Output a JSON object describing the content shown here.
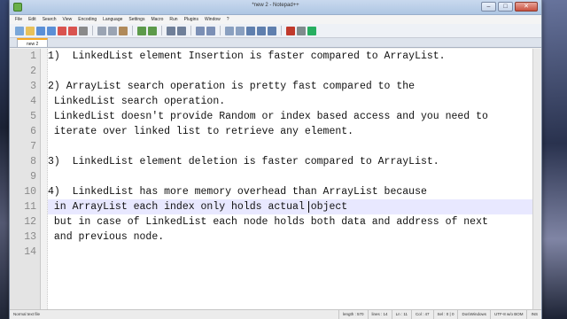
{
  "window": {
    "title": "*new 2 - Notepad++",
    "controls": {
      "minimize": "–",
      "maximize": "□",
      "close": "✕"
    }
  },
  "menu": [
    "File",
    "Edit",
    "Search",
    "View",
    "Encoding",
    "Language",
    "Settings",
    "Macro",
    "Run",
    "Plugins",
    "Window",
    "?"
  ],
  "toolbar_icons": [
    "new-file-icon",
    "open-file-icon",
    "save-icon",
    "save-all-icon",
    "close-icon",
    "close-all-icon",
    "print-icon",
    "cut-icon",
    "copy-icon",
    "paste-icon",
    "undo-icon",
    "redo-icon",
    "find-icon",
    "replace-icon",
    "zoom-in-icon",
    "zoom-out-icon",
    "sync-v-icon",
    "sync-h-icon",
    "word-wrap-icon",
    "show-all-icon",
    "indent-guide-icon",
    "record-macro-icon",
    "stop-macro-icon",
    "play-macro-icon"
  ],
  "tab": {
    "label": "new 2"
  },
  "editor": {
    "current_line": 11,
    "lines": [
      {
        "n": "1",
        "text": "1)  LinkedList element Insertion is faster compared to ArrayList."
      },
      {
        "n": "2",
        "text": ""
      },
      {
        "n": "3",
        "text": "2) ArrayList search operation is pretty fast compared to the"
      },
      {
        "n": "4",
        "text": " LinkedList search operation."
      },
      {
        "n": "5",
        "text": " LinkedList doesn't provide Random or index based access and you need to"
      },
      {
        "n": "6",
        "text": " iterate over linked list to retrieve any element."
      },
      {
        "n": "7",
        "text": ""
      },
      {
        "n": "8",
        "text": "3)  LinkedList element deletion is faster compared to ArrayList."
      },
      {
        "n": "9",
        "text": ""
      },
      {
        "n": "10",
        "text": "4)  LinkedList has more memory overhead than ArrayList because"
      },
      {
        "n": "11",
        "text": " in ArrayList each index only holds actual object"
      },
      {
        "n": "12",
        "text": " but in case of LinkedList each node holds both data and address of next"
      },
      {
        "n": "13",
        "text": " and previous node."
      },
      {
        "n": "14",
        "text": ""
      }
    ]
  },
  "status": {
    "file_type": "Normal text file",
    "length": "length : 570",
    "lines": "lines : 14",
    "position": "Ln : 11",
    "col": "Col : 47",
    "sel": "Sel : 0 | 0",
    "eol": "Dos\\Windows",
    "encoding": "UTF-8 w/o BOM",
    "mode": "INS"
  },
  "colors": {
    "current_line": "#e8e8ff",
    "gutter": "#e4e4e4",
    "tab_accent": "#f5a623"
  }
}
